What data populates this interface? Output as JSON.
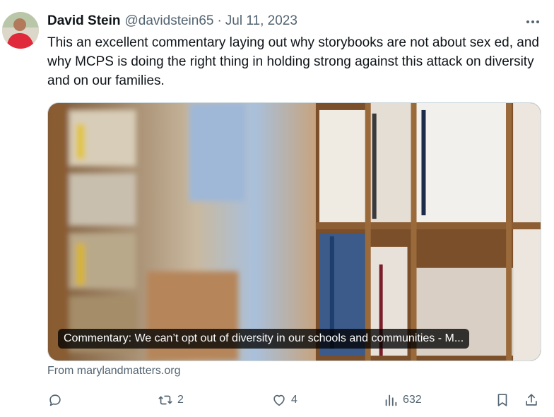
{
  "post": {
    "author_name": "David Stein",
    "author_handle": "@davidstein65",
    "separator": "·",
    "date": "Jul 11, 2023",
    "text": "This an excellent commentary laying out why storybooks  are not about sex ed, and why MCPS is doing the right thing in holding strong against this attack on diversity and on our families."
  },
  "card": {
    "title": "Commentary: We can’t opt out of diversity in our schools and communities  - M...",
    "source": "From marylandmatters.org"
  },
  "actions": {
    "reply_count": "",
    "repost_count": "2",
    "like_count": "4",
    "view_count": "632"
  },
  "icons": {
    "more": "more-horizontal-icon",
    "reply": "reply-bubble-icon",
    "repost": "repost-arrows-icon",
    "like": "heart-icon",
    "views": "bar-chart-icon",
    "bookmark": "bookmark-icon",
    "share": "share-upload-icon"
  },
  "colors": {
    "secondary_text": "#536471",
    "primary_text": "#0f1419",
    "avatar_shirt": "#e0293a"
  }
}
